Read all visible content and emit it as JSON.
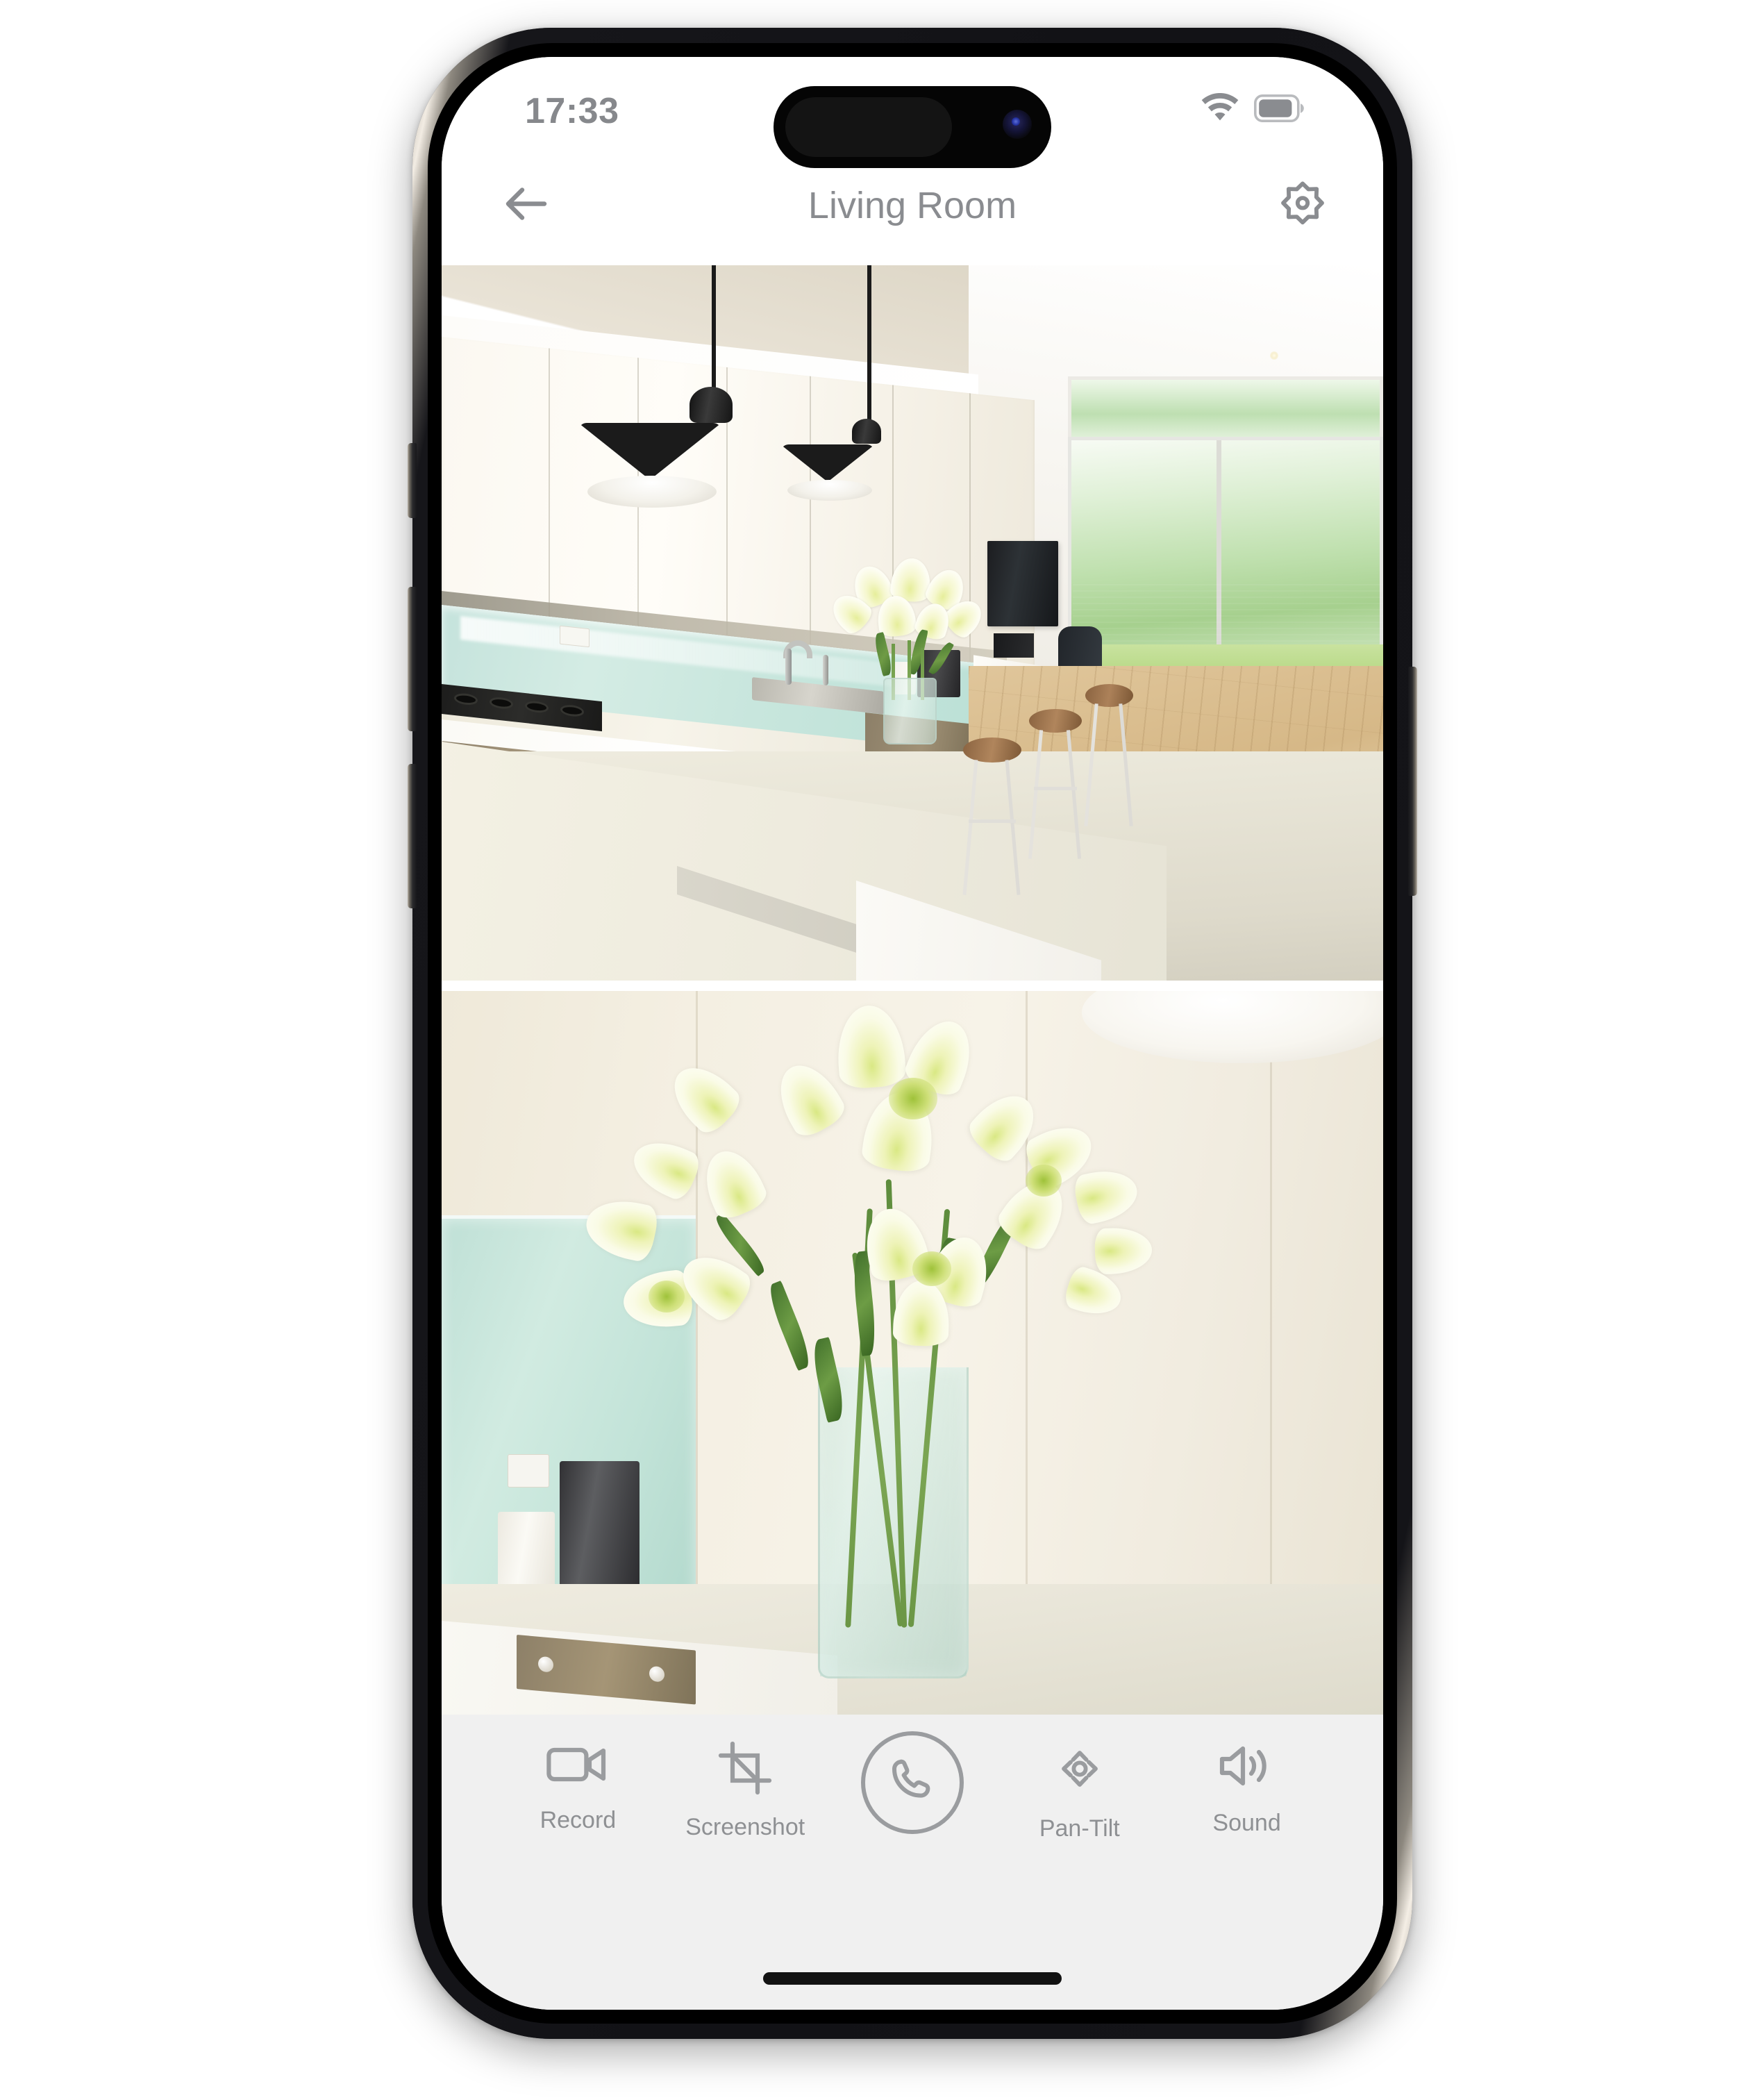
{
  "device": {
    "hardware_buttons": [
      {
        "name": "action-button",
        "side": "left"
      },
      {
        "name": "volume-up-button",
        "side": "left"
      },
      {
        "name": "volume-down-button",
        "side": "left"
      },
      {
        "name": "power-button",
        "side": "right"
      }
    ]
  },
  "status_bar": {
    "time": "17:33",
    "wifi_icon": "wifi-icon",
    "battery_icon": "battery-icon",
    "battery_level_percent": 80,
    "icon_color": "#8a8c90"
  },
  "nav_bar": {
    "back_icon": "arrow-left-icon",
    "title": "Living Room",
    "settings_icon": "gear-icon",
    "text_color": "#8a8c90"
  },
  "feeds": [
    {
      "name": "camera-feed-top",
      "scene": "Open-plan kitchen with white gloss cabinets, mint glass splashback, two black pendant lamps, vase of white lilies on the island bench, bar stools and sliding glass doors to a green garden"
    },
    {
      "name": "camera-feed-bottom",
      "scene": "Close-up of white lilies in a tall clear glass vase on a kitchen counter with mint splashback and a stainless coffee machine"
    }
  ],
  "toolbar": {
    "background": "#f0f0f0",
    "icon_color": "#9a9c9f",
    "label_color": "#8e9093",
    "items": [
      {
        "icon": "video-camera-icon",
        "label": "Record"
      },
      {
        "icon": "crop-icon",
        "label": "Screenshot"
      },
      {
        "icon": "phone-call-icon",
        "label": ""
      },
      {
        "icon": "pan-tilt-icon",
        "label": "Pan-Tilt"
      },
      {
        "icon": "speaker-volume-icon",
        "label": "Sound"
      }
    ]
  },
  "home_indicator": {
    "name": "home-indicator"
  }
}
